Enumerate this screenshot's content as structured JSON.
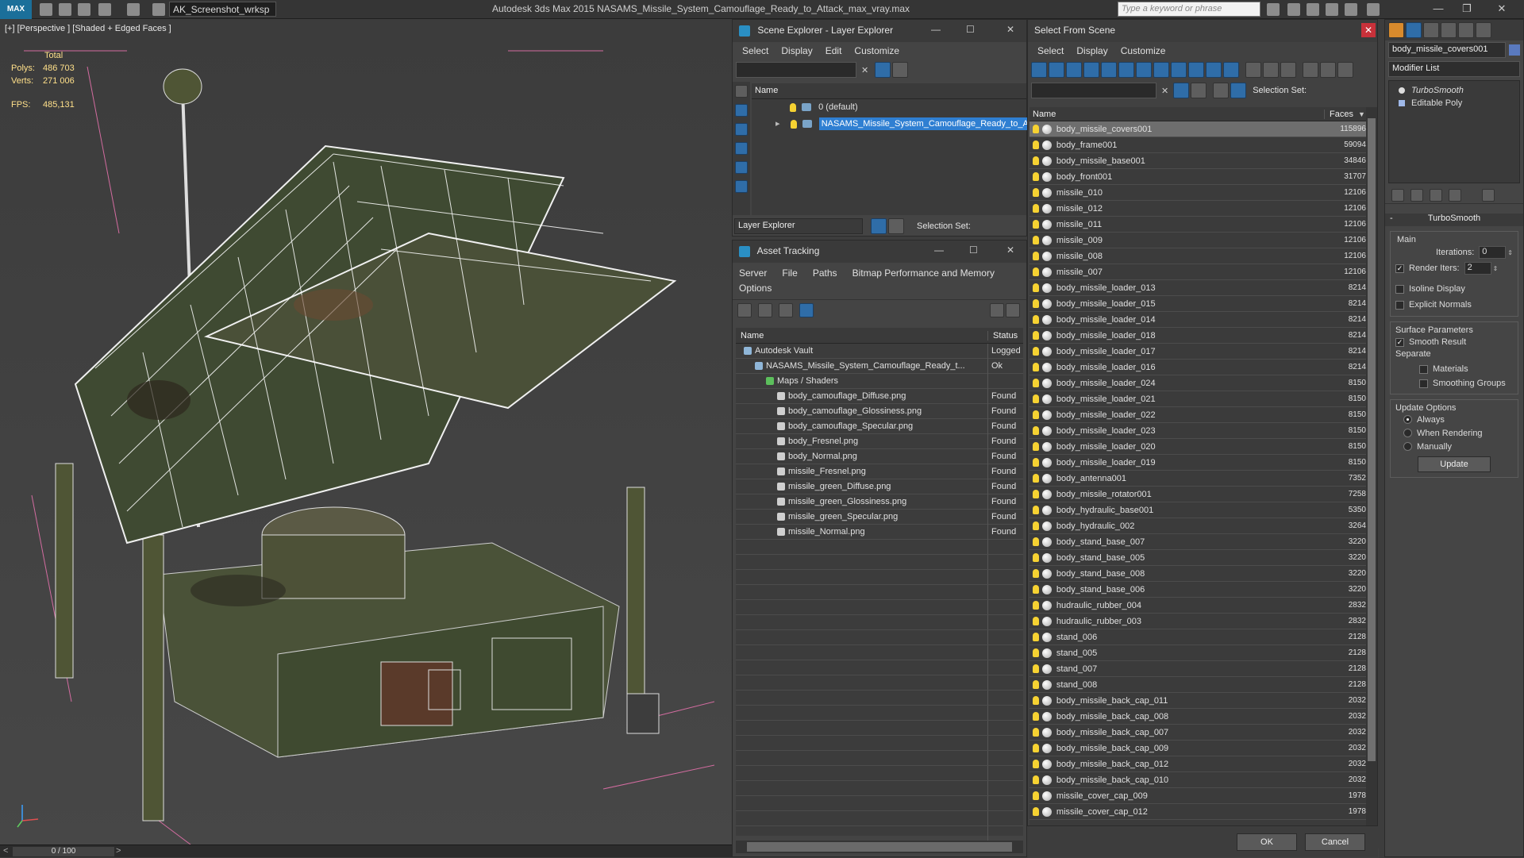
{
  "app": {
    "logo": "MAX",
    "workspace": "AK_Screenshot_wrksp",
    "title": "Autodesk 3ds Max  2015    NASAMS_Missile_System_Camouflage_Ready_to_Attack_max_vray.max",
    "search_placeholder": "Type a keyword or phrase"
  },
  "viewport": {
    "label": "[+] [Perspective ] [Shaded + Edged Faces ]",
    "stats": {
      "header": "Total",
      "polys_label": "Polys:",
      "polys": "486 703",
      "verts_label": "Verts:",
      "verts": "271 006",
      "fps_label": "FPS:",
      "fps": "485,131"
    },
    "timeline": "0 / 100"
  },
  "scene_explorer": {
    "title": "Scene Explorer - Layer Explorer",
    "menu": [
      "Select",
      "Display",
      "Edit",
      "Customize"
    ],
    "col_name": "Name",
    "layers": [
      {
        "name": "0 (default)",
        "selected": false
      },
      {
        "name": "NASAMS_Missile_System_Camouflage_Ready_to_Attack",
        "selected": true
      }
    ],
    "footer_combo": "Layer Explorer",
    "selection_set": "Selection Set:"
  },
  "asset_tracking": {
    "title": "Asset Tracking",
    "menu": [
      "Server",
      "File",
      "Paths",
      "Bitmap Performance and Memory",
      "Options"
    ],
    "col_name": "Name",
    "col_status": "Status",
    "rows": [
      {
        "name": "Autodesk Vault",
        "status": "Logged",
        "indent": 0
      },
      {
        "name": "NASAMS_Missile_System_Camouflage_Ready_t...",
        "status": "Ok",
        "indent": 1
      },
      {
        "name": "Maps / Shaders",
        "status": "",
        "indent": 2
      },
      {
        "name": "body_camouflage_Diffuse.png",
        "status": "Found",
        "indent": 3
      },
      {
        "name": "body_camouflage_Glossiness.png",
        "status": "Found",
        "indent": 3
      },
      {
        "name": "body_camouflage_Specular.png",
        "status": "Found",
        "indent": 3
      },
      {
        "name": "body_Fresnel.png",
        "status": "Found",
        "indent": 3
      },
      {
        "name": "body_Normal.png",
        "status": "Found",
        "indent": 3
      },
      {
        "name": "missile_Fresnel.png",
        "status": "Found",
        "indent": 3
      },
      {
        "name": "missile_green_Diffuse.png",
        "status": "Found",
        "indent": 3
      },
      {
        "name": "missile_green_Glossiness.png",
        "status": "Found",
        "indent": 3
      },
      {
        "name": "missile_green_Specular.png",
        "status": "Found",
        "indent": 3
      },
      {
        "name": "missile_Normal.png",
        "status": "Found",
        "indent": 3
      }
    ]
  },
  "select_from_scene": {
    "title": "Select From Scene",
    "menu": [
      "Select",
      "Display",
      "Customize"
    ],
    "selection_set": "Selection Set:",
    "col_name": "Name",
    "col_faces": "Faces",
    "rows": [
      {
        "name": "body_missile_covers001",
        "faces": "115896"
      },
      {
        "name": "body_frame001",
        "faces": "59094"
      },
      {
        "name": "body_missile_base001",
        "faces": "34846"
      },
      {
        "name": "body_front001",
        "faces": "31707"
      },
      {
        "name": "missile_010",
        "faces": "12106"
      },
      {
        "name": "missile_012",
        "faces": "12106"
      },
      {
        "name": "missile_011",
        "faces": "12106"
      },
      {
        "name": "missile_009",
        "faces": "12106"
      },
      {
        "name": "missile_008",
        "faces": "12106"
      },
      {
        "name": "missile_007",
        "faces": "12106"
      },
      {
        "name": "body_missile_loader_013",
        "faces": "8214"
      },
      {
        "name": "body_missile_loader_015",
        "faces": "8214"
      },
      {
        "name": "body_missile_loader_014",
        "faces": "8214"
      },
      {
        "name": "body_missile_loader_018",
        "faces": "8214"
      },
      {
        "name": "body_missile_loader_017",
        "faces": "8214"
      },
      {
        "name": "body_missile_loader_016",
        "faces": "8214"
      },
      {
        "name": "body_missile_loader_024",
        "faces": "8150"
      },
      {
        "name": "body_missile_loader_021",
        "faces": "8150"
      },
      {
        "name": "body_missile_loader_022",
        "faces": "8150"
      },
      {
        "name": "body_missile_loader_023",
        "faces": "8150"
      },
      {
        "name": "body_missile_loader_020",
        "faces": "8150"
      },
      {
        "name": "body_missile_loader_019",
        "faces": "8150"
      },
      {
        "name": "body_antenna001",
        "faces": "7352"
      },
      {
        "name": "body_missile_rotator001",
        "faces": "7258"
      },
      {
        "name": "body_hydraulic_base001",
        "faces": "5350"
      },
      {
        "name": "body_hydraulic_002",
        "faces": "3264"
      },
      {
        "name": "body_stand_base_007",
        "faces": "3220"
      },
      {
        "name": "body_stand_base_005",
        "faces": "3220"
      },
      {
        "name": "body_stand_base_008",
        "faces": "3220"
      },
      {
        "name": "body_stand_base_006",
        "faces": "3220"
      },
      {
        "name": "hudraulic_rubber_004",
        "faces": "2832"
      },
      {
        "name": "hudraulic_rubber_003",
        "faces": "2832"
      },
      {
        "name": "stand_006",
        "faces": "2128"
      },
      {
        "name": "stand_005",
        "faces": "2128"
      },
      {
        "name": "stand_007",
        "faces": "2128"
      },
      {
        "name": "stand_008",
        "faces": "2128"
      },
      {
        "name": "body_missile_back_cap_011",
        "faces": "2032"
      },
      {
        "name": "body_missile_back_cap_008",
        "faces": "2032"
      },
      {
        "name": "body_missile_back_cap_007",
        "faces": "2032"
      },
      {
        "name": "body_missile_back_cap_009",
        "faces": "2032"
      },
      {
        "name": "body_missile_back_cap_012",
        "faces": "2032"
      },
      {
        "name": "body_missile_back_cap_010",
        "faces": "2032"
      },
      {
        "name": "missile_cover_cap_009",
        "faces": "1978"
      },
      {
        "name": "missile_cover_cap_012",
        "faces": "1978"
      }
    ],
    "ok": "OK",
    "cancel": "Cancel"
  },
  "modify": {
    "object_name": "body_missile_covers001",
    "modifier_list": "Modifier List",
    "stack": [
      "TurboSmooth",
      "Editable Poly"
    ],
    "rollout_title": "TurboSmooth",
    "main_label": "Main",
    "iterations_label": "Iterations:",
    "iterations": "0",
    "render_iters_label": "Render Iters:",
    "render_iters": "2",
    "isoline": "Isoline Display",
    "explicit_normals": "Explicit Normals",
    "surface_params": "Surface Parameters",
    "smooth_result": "Smooth Result",
    "separate": "Separate",
    "materials": "Materials",
    "smoothing_groups": "Smoothing Groups",
    "update_options": "Update Options",
    "always": "Always",
    "when_rendering": "When Rendering",
    "manually": "Manually",
    "update": "Update"
  }
}
